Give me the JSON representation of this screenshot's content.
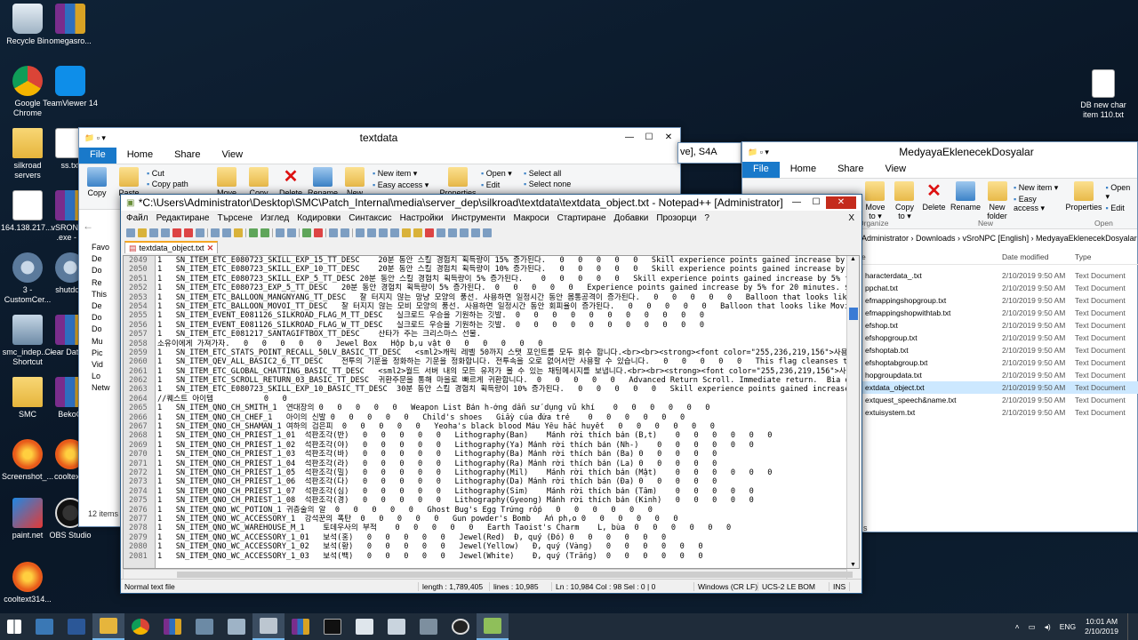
{
  "desktop": {
    "icons_left": [
      {
        "label": "Recycle Bin",
        "icon": "bin"
      },
      {
        "label": "omegasro...",
        "icon": "rar"
      },
      {
        "label": "Google Chrome",
        "icon": "chrome"
      },
      {
        "label": "TeamViewer 14",
        "icon": "tv"
      },
      {
        "label": "silkroad servers",
        "icon": "folder"
      },
      {
        "label": "ss.txt",
        "icon": "doc"
      },
      {
        "label": "164.138.217....",
        "icon": "doc"
      },
      {
        "label": "vSRONPC .exe - S",
        "icon": "rar"
      },
      {
        "label": "3 - CustomCer...",
        "icon": "gear"
      },
      {
        "label": "shutdow",
        "icon": "gear"
      },
      {
        "label": "smc_indep... - Shortcut",
        "icon": "smc"
      },
      {
        "label": "Clear Databas",
        "icon": "rar"
      },
      {
        "label": "SMC",
        "icon": "folder"
      },
      {
        "label": "BekoO",
        "icon": "rar"
      },
      {
        "label": "Screenshot_...",
        "icon": "orange"
      },
      {
        "label": "cooltext3",
        "icon": "orange"
      },
      {
        "label": "paint.net",
        "icon": "paint"
      },
      {
        "label": "OBS Studio",
        "icon": "obs"
      },
      {
        "label": "cooltext314...",
        "icon": "orange"
      }
    ],
    "icon_right": {
      "label": "DB new char item 110.txt",
      "icon": "doc"
    }
  },
  "explorer_left": {
    "title": "textdata",
    "tabs": [
      "File",
      "Home",
      "Share",
      "View"
    ],
    "ribbon": {
      "copy": "Copy",
      "paste": "Paste",
      "cut": "Cut",
      "copy_path": "Copy path",
      "move": "Move",
      "copy_to": "Copy",
      "delete": "Delete",
      "rename": "Rename",
      "new": "New",
      "new_item": "New item ▾",
      "easy_access": "Easy access ▾",
      "properties": "Properties",
      "open": "Open ▾",
      "edit": "Edit",
      "select_all": "Select all",
      "select_none": "Select none"
    },
    "nav": [
      "Favo",
      "De",
      "Do",
      "Re",
      "This",
      "De",
      "Do",
      "Do",
      "Mu",
      "Pic",
      "Vid",
      "Lo",
      "Netw"
    ],
    "count": "12 items"
  },
  "explorer_mid_title": "ve], S4A",
  "explorer_right": {
    "title": "MedyayaEklenecekDosyalar",
    "tabs": [
      "File",
      "Home",
      "Share",
      "View"
    ],
    "ribbon": {
      "cut": "Cut",
      "move_to": "Move to ▾",
      "copy_to": "Copy to ▾",
      "delete": "Delete",
      "rename": "Rename",
      "new_folder": "New folder",
      "new_item": "New item ▾",
      "easy_access": "Easy access ▾",
      "properties": "Properties",
      "open": "Open ▾",
      "edit": "Edit",
      "organize": "Organize",
      "new_group": "New",
      "open_group": "Open"
    },
    "breadcrumb": "Administrator  ›  Downloads  ›  vSroNPC [English]  ›  MedyayaEklenecekDosyalar",
    "col_name": "e",
    "col_date": "Date modified",
    "col_type": "Type",
    "files": [
      {
        "name": "haracterdata_.txt",
        "date": "2/10/2019 9:50 AM",
        "type": "Text Document"
      },
      {
        "name": "ppchat.txt",
        "date": "2/10/2019 9:50 AM",
        "type": "Text Document"
      },
      {
        "name": "efmappingshopgroup.txt",
        "date": "2/10/2019 9:50 AM",
        "type": "Text Document"
      },
      {
        "name": "efmappingshopwithtab.txt",
        "date": "2/10/2019 9:50 AM",
        "type": "Text Document"
      },
      {
        "name": "efshop.txt",
        "date": "2/10/2019 9:50 AM",
        "type": "Text Document"
      },
      {
        "name": "efshopgroup.txt",
        "date": "2/10/2019 9:50 AM",
        "type": "Text Document"
      },
      {
        "name": "efshoptab.txt",
        "date": "2/10/2019 9:50 AM",
        "type": "Text Document"
      },
      {
        "name": "efshoptabgroup.txt",
        "date": "2/10/2019 9:50 AM",
        "type": "Text Document"
      },
      {
        "name": "hopgroupdata.txt",
        "date": "2/10/2019 9:50 AM",
        "type": "Text Document"
      },
      {
        "name": "extdata_object.txt",
        "date": "2/10/2019 9:50 AM",
        "type": "Text Document"
      },
      {
        "name": "extquest_speech&name.txt",
        "date": "2/10/2019 9:50 AM",
        "type": "Text Document"
      },
      {
        "name": "extuisystem.txt",
        "date": "2/10/2019 9:50 AM",
        "type": "Text Document"
      }
    ],
    "status": "s"
  },
  "notepad": {
    "title": "*C:\\Users\\Administrator\\Desktop\\SMC\\Patch_Internal\\media\\server_dep\\silkroad\\textdata\\textdata_object.txt - Notepad++ [Administrator]",
    "menu": [
      "Файл",
      "Редактиране",
      "Търсене",
      "Изглед",
      "Кодировки",
      "Синтаксис",
      "Настройки",
      "Инструменти",
      "Макроси",
      "Стартиране",
      "Добавки",
      "Прозорци",
      "?"
    ],
    "menu_close": "X",
    "tab": "textdata_object.txt",
    "lines": [
      {
        "n": "2049",
        "t": "1   SN_ITEM_ETC_E080723_SKILL_EXP_15_TT_DESC    20분 동안 스킬 경험치 획득량이 15% 증가된다.   0   0   0   0   0   Skill experience points gained increase by 15"
      },
      {
        "n": "2050",
        "t": "1   SN_ITEM_ETC_E080723_SKILL_EXP_10_TT_DESC    20분 동안 스킬 경험치 획득량이 10% 증가된다.   0   0   0   0   0   Skill experience points gained increase by 10"
      },
      {
        "n": "2051",
        "t": "1   SN_ITEM_ETC_E080723_SKILL_EXP_5_TT_DESC 20분 동안 스킬 경험치 획득량이 5% 증가된다.    0   0   0   0   0   Skill experience points gained increase by 5% for"
      },
      {
        "n": "2052",
        "t": "1   SN_ITEM_ETC_E080723_EXP_5_TT_DESC   20분 동안 경험치 획득량이 5% 증가된다.  0   0   0   0   0   Experience points gained increase by 5% for 20 minutes. $"
      },
      {
        "n": "2053",
        "t": "1   SN_ITEM_ETC_BALLOON_MANGNYANG_TT_DESC   잘 터지지 않는 망냥 모양의 풍선. 사용하면 일정시간 동안 몸통공격이 증가된다.   0   0   0   0   0   Balloon that looks like Mangnyang"
      },
      {
        "n": "2054",
        "t": "1   SN_ITEM_ETC_BALLOON_MOVOI_TT_DESC   잘 터지지 않는 모비 모양의 풍선. 사용하면 일정시간 동안 회피율이 증가된다.   0   0   0   0   0   Balloon that looks like Movia. Wh"
      },
      {
        "n": "2055",
        "t": "1   SN_ITEM_EVENT_E081126_SILKROAD_FLAG_M_TT_DESC   실크로드 우승을 기원하는 깃발.  0   0   0   0   0   0   0   0   0   0   0"
      },
      {
        "n": "2056",
        "t": "1   SN_ITEM_EVENT_E081126_SILKROAD_FLAG_W_TT_DESC   실크로드 우승을 기원하는 깃발.  0   0   0   0   0   0   0   0   0   0   0"
      },
      {
        "n": "2057",
        "t": "1   SN_ITEM_ETC_E081217_SANTAGIFTBOX_TT_DESC    산타가 주는 크리스마스 선물."
      },
      {
        "n": "2058",
        "t": "소유이에게 가져가자.   0   0   0   0   0   Jewel Box   Hộp b,u vật 0   0   0   0   0   0"
      },
      {
        "n": "2059",
        "t": "1   SN_ITEM_ETC_STATS_POINT_RECALL_50LV_BASIC_TT_DESC   <sml2>캐릭 레벨 50까지 스탯 포인트를 모두 회수 합니다.<br><br><strong><font color=\"255,236,219,156\">사용입니</"
      },
      {
        "n": "2060",
        "t": "1   SN_ITEM_QEV_ALL_BASIC2_6_TT_DESC    전투의 기운을 정화하는 기운을 정화합니다. 전투속을 오로 없어서만 사용할 수 있습니다.   0   0   0   0   0   This flag cleanses the ominous en"
      },
      {
        "n": "2061",
        "t": "1   SN_ITEM_ETC_GLOBAL_CHATTING_BASIC_TT_DESC   <sml2>월드 서버 내의 모든 유저가 볼 수 있는 채팅메시지를 보냅니다.<br><br><strong><font color=\"255,236,219,156\">사용방법</"
      },
      {
        "n": "2062",
        "t": "1   SN_ITEM_ETC_SCROLL_RETURN_03_BASIC_TT_DESC  귀환주문을 통해 마을로 빠르게 귀환합니다.  0   0   0   0   0   Advanced Return Scroll. Immediate return.  Bia dịch"
      },
      {
        "n": "2063",
        "t": "1   SN_ITEM_ETC_E080723_SKILL_EXP_10_BASIC_TT_DESC  30분 동안 스킬 경험치 획득량이 10% 증가된다.   0   0   0   0   0   Skill experience points gained increase b"
      },
      {
        "n": "2064",
        "t": "//퀘스트 아이템           0   0"
      },
      {
        "n": "2065",
        "t": "1   SN_ITEM_QNO_CH_SMITH_1  연대장의 0   0   0   0   0   Weapon List Bản h-ớng dẫn sử dụng vũ khí    0   0   0   0   0   0"
      },
      {
        "n": "2066",
        "t": "1   SN_ITEM_QNO_CH_CHEF_1   아이의 신발 0   0   0   0   0   Child's shoes   Giầy của đứa trẻ    0   0   0   0   0   0"
      },
      {
        "n": "2067",
        "t": "1   SN_ITEM_QNO_CH_SHAMAN_1 여하의 검은피  0   0   0   0   0   Yeoha's black blood Máu Yêu hắc huyết   0   0   0   0   0   0"
      },
      {
        "n": "2068",
        "t": "1   SN_ITEM_QNO_CH_PRIEST_1_01  석판조각(반)   0   0   0   0   0   Lithography(Ban)    Mảnh rời thích bản (B,t)    0   0   0   0   0   0"
      },
      {
        "n": "2069",
        "t": "1   SN_ITEM_QNO_CH_PRIEST_1_02  석판조각(야)   0   0   0   0   0   Lithography(Ya) Mảnh rời thích bản (Nh-)    0   0   0   0   0   0"
      },
      {
        "n": "2070",
        "t": "1   SN_ITEM_QNO_CH_PRIEST_1_03  석판조각(바)   0   0   0   0   0   Lithography(Ba) Mảnh rời thích bản (Ba) 0   0   0   0   0"
      },
      {
        "n": "2071",
        "t": "1   SN_ITEM_QNO_CH_PRIEST_1_04  석판조각(라)   0   0   0   0   0   Lithography(Ra) Mảnh rời thích bản (La) 0   0   0   0   0"
      },
      {
        "n": "2072",
        "t": "1   SN_ITEM_QNO_CH_PRIEST_1_05  석판조각(밀)   0   0   0   0   0   Lithography(Mil)    Mảnh rời thích bản (Mật)    0   0   0   0   0   0"
      },
      {
        "n": "2073",
        "t": "1   SN_ITEM_QNO_CH_PRIEST_1_06  석판조각(다)   0   0   0   0   0   Lithography(Da) Mảnh rời thích bản (Đa) 0   0   0   0   0"
      },
      {
        "n": "2074",
        "t": "1   SN_ITEM_QNO_CH_PRIEST_1_07  석판조각(심)   0   0   0   0   0   Lithography(Sim)    Mảnh rời thích bản (Tâm)    0   0   0   0   0"
      },
      {
        "n": "2075",
        "t": "1   SN_ITEM_QNO_CH_PRIEST_1_08  석판조각(경)   0   0   0   0   0   Lithography(Gyeong) Mảnh rời thích bản (Kinh)   0   0   0   0   0"
      },
      {
        "n": "2076",
        "t": "1   SN_ITEM_QNO_WC_POTION_1 귀층술의 알  0   0   0   0   0   Ghost Bug's Egg Trứng rốp   0   0   0   0   0   0"
      },
      {
        "n": "2077",
        "t": "1   SN_ITEM_QNO_WC_ACCESSORY_1  강석꾼의 폭탄  0   0   0   0   0   Gun powder's Bomb   Ấn ph,o 0   0   0   0   0   0"
      },
      {
        "n": "2078",
        "t": "1   SN_ITEM_QNO_WC_WAREHOUSE_M_1    토데우사의 부적    0   0   0   0   0   Earth Taoist's Charm    L, bùa  0   0   0   0   0   0"
      },
      {
        "n": "2079",
        "t": "1   SN_ITEM_QNO_WC_ACCESSORY_1_01   보석(홍)   0   0   0   0   0   Jewel(Red)  Đ, quý (Đỏ) 0   0   0   0   0   0"
      },
      {
        "n": "2080",
        "t": "1   SN_ITEM_QNO_WC_ACCESSORY_1_02   보석(황)   0   0   0   0   0   Jewel(Yellow)   Đ, quý (Vàng)   0   0   0   0   0   0"
      },
      {
        "n": "2081",
        "t": "1   SN_ITEM_QNO_WC_ACCESSORY_1_03   보석(백)   0   0   0   0   0   Jewel(White)    Đ, quý (Trắng)  0   0   0   0   0   0"
      }
    ],
    "status": {
      "type": "Normal text file",
      "length": "length : 1,789,405",
      "lines": "lines : 10,985",
      "pos": "Ln : 10,984    Col : 98    Sel : 0 | 0",
      "eol": "Windows (CR LF)",
      "enc": "UCS-2 LE BOM",
      "mode": "INS"
    }
  },
  "taskbar": {
    "lang": "ENG",
    "time": "10:01 AM",
    "date": "2/10/2019"
  }
}
